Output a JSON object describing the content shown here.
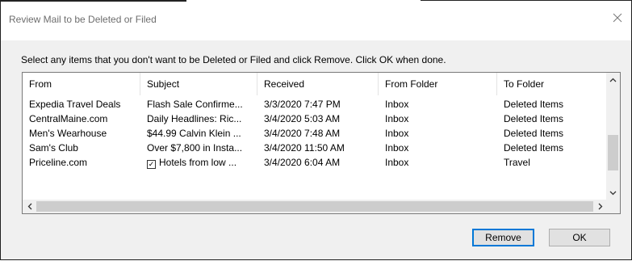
{
  "window": {
    "title": "Review Mail to be Deleted or Filed",
    "close_icon": "close-icon"
  },
  "instruction": "Select any items that you don't want to be Deleted or Filed and click Remove. Click OK when done.",
  "list": {
    "columns": [
      "From",
      "Subject",
      "Received",
      "From Folder",
      "To Folder"
    ],
    "rows": [
      {
        "from": "Expedia Travel Deals",
        "subject": "Flash Sale Confirme...",
        "received": "3/3/2020 7:47 PM",
        "from_folder": "Inbox",
        "to_folder": "Deleted Items",
        "checked": false
      },
      {
        "from": "CentralMaine.com",
        "subject": "Daily Headlines: Ric...",
        "received": "3/4/2020 5:03 AM",
        "from_folder": "Inbox",
        "to_folder": "Deleted Items",
        "checked": false
      },
      {
        "from": "Men's Wearhouse",
        "subject": "$44.99 Calvin Klein ...",
        "received": "3/4/2020 7:48 AM",
        "from_folder": "Inbox",
        "to_folder": "Deleted Items",
        "checked": false
      },
      {
        "from": "Sam's Club",
        "subject": "Over $7,800 in Insta...",
        "received": "3/4/2020 11:50 AM",
        "from_folder": "Inbox",
        "to_folder": "Deleted Items",
        "checked": false
      },
      {
        "from": "Priceline.com",
        "subject": "Hotels from low ...",
        "received": "3/4/2020 6:04 AM",
        "from_folder": "Inbox",
        "to_folder": "Travel",
        "checked": true
      }
    ]
  },
  "buttons": {
    "remove": "Remove",
    "ok": "OK"
  },
  "colors": {
    "accent": "#0078d7",
    "dialog_bg": "#f0f0f0",
    "scroll_thumb": "#cdcdcd"
  }
}
